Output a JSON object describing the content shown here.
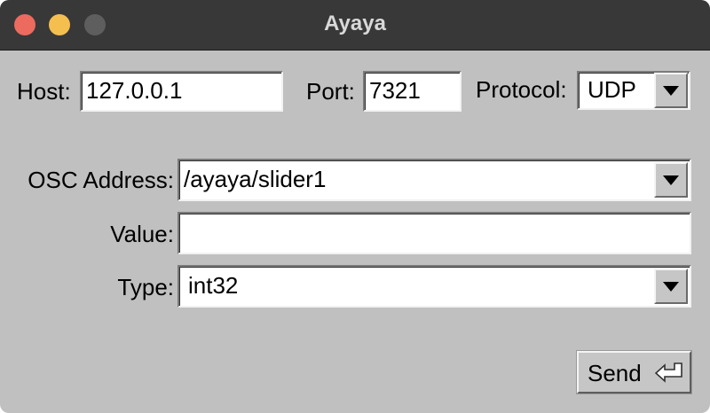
{
  "window": {
    "title": "Ayaya"
  },
  "connection": {
    "host_label": "Host:",
    "host_value": "127.0.0.1",
    "port_label": "Port:",
    "port_value": "7321",
    "protocol_label": "Protocol:",
    "protocol_value": "UDP"
  },
  "message": {
    "address_label": "OSC Address:",
    "address_value": "/ayaya/slider1",
    "value_label": "Value:",
    "value_value": "",
    "type_label": "Type:",
    "type_value": "int32"
  },
  "actions": {
    "send_label": "Send",
    "send_icon": "return-icon"
  },
  "colors": {
    "window_background": "#c0c0c0",
    "titlebar_background": "#383838",
    "close_button": "#ed6a5e",
    "minimize_button": "#f5bf4f",
    "maximize_button": "#5e5e5e"
  }
}
